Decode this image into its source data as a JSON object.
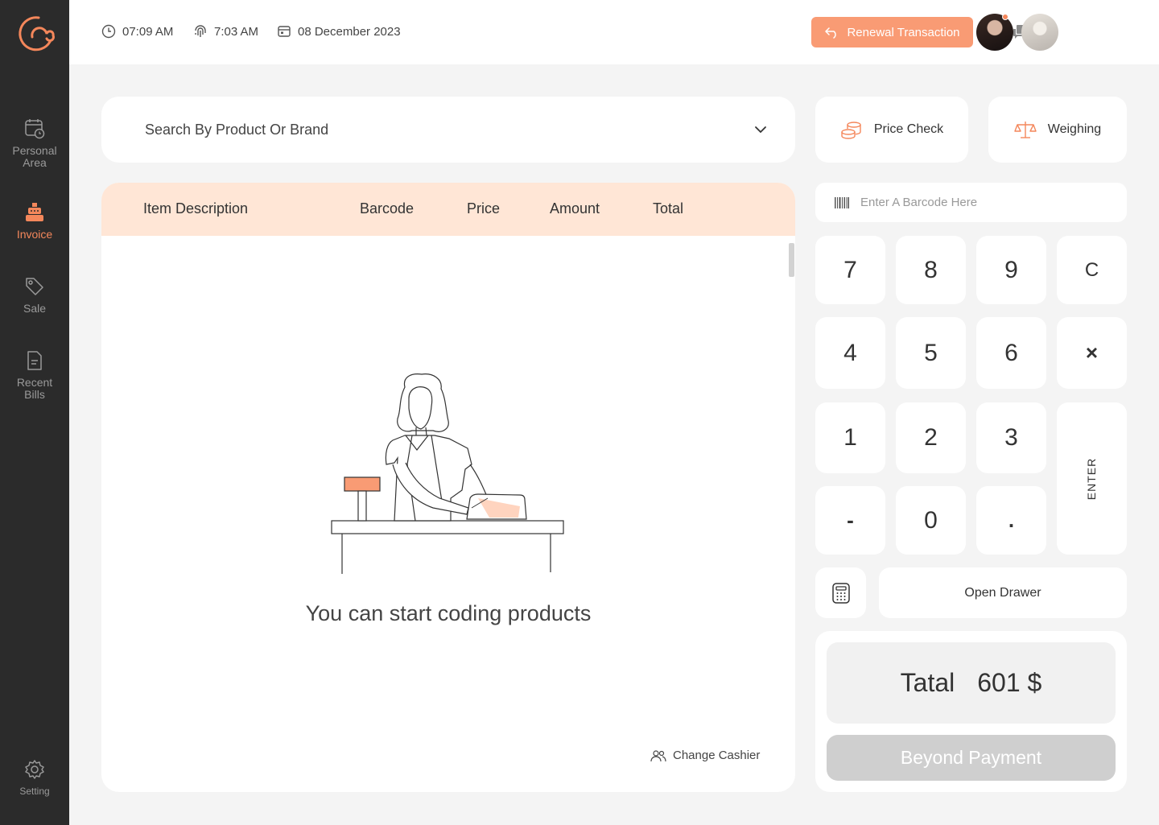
{
  "nav": {
    "items": [
      {
        "label": "Personal Area",
        "icon": "calendar-clock-icon"
      },
      {
        "label": "Invoice",
        "icon": "cash-register-icon",
        "active": true
      },
      {
        "label": "Sale",
        "icon": "tag-icon"
      },
      {
        "label": "Recent Bills",
        "icon": "bill-icon"
      }
    ],
    "setting": {
      "label": "Setting",
      "icon": "gear-icon"
    }
  },
  "header": {
    "time": "07:09 AM",
    "checkin_time": "7:03 AM",
    "date": "08 December 2023",
    "renewal_label": "Renewal Transaction"
  },
  "search": {
    "label": "Search By Product Or Brand"
  },
  "tools": {
    "price_check": "Price Check",
    "weighing": "Weighing"
  },
  "table": {
    "columns": [
      "Item Description",
      "Barcode",
      "Price",
      "Amount",
      "Total"
    ],
    "rows": [],
    "empty_text": "You can start coding products",
    "change_cashier": "Change Cashier"
  },
  "barcode": {
    "placeholder": "Enter A Barcode Here"
  },
  "keypad": {
    "row1": [
      "7",
      "8",
      "9",
      "C"
    ],
    "row2": [
      "4",
      "5",
      "6",
      "×"
    ],
    "row3": [
      "1",
      "2",
      "3"
    ],
    "row4": [
      "-",
      "0",
      "."
    ],
    "enter": "ENTER"
  },
  "drawer": {
    "label": "Open Drawer"
  },
  "summary": {
    "total_label": "Tatal",
    "total_value": "601 $",
    "pay_label": "Beyond Payment"
  },
  "colors": {
    "accent": "#f4875b",
    "accent_light": "#ffe6d6",
    "sidebar": "#2b2b2b",
    "renew_button": "#f99b74"
  }
}
